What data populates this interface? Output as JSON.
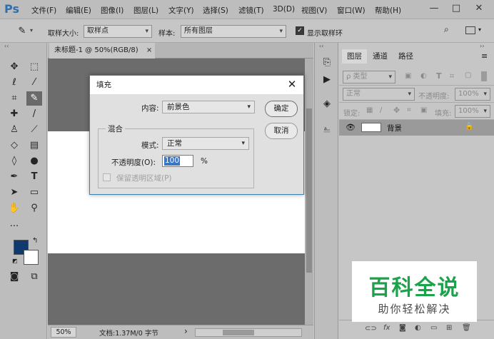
{
  "app": {
    "logo": "Ps"
  },
  "menu": [
    "文件(F)",
    "编辑(E)",
    "图像(I)",
    "图层(L)",
    "文字(Y)",
    "选择(S)",
    "滤镜(T)",
    "3D(D)",
    "视图(V)",
    "窗口(W)",
    "帮助(H)"
  ],
  "window_controls": {
    "minimize": "—",
    "restore": "□",
    "close": "✕"
  },
  "options": {
    "sample_size_label": "取样大小:",
    "sample_size_value": "取样点",
    "sample_label": "样本:",
    "sample_value": "所有图层",
    "show_ring_label": "显示取样环",
    "show_ring_checked": true
  },
  "document": {
    "tab_title": "未标题-1 @ 50%(RGB/8)",
    "tab_close": "×",
    "zoom": "50%",
    "doc_info": "文档:1.37M/0 字节",
    "status_arrow": "›"
  },
  "layers_panel": {
    "tabs": [
      "图层",
      "通道",
      "路径"
    ],
    "filter_kind": "ρ 类型",
    "blend_mode": "正常",
    "opacity_label": "不透明度:",
    "opacity_value": "100%",
    "lock_label": "锁定:",
    "fill_label": "填充:",
    "fill_value": "100%",
    "layer_name": "背景"
  },
  "fill_dialog": {
    "title": "填充",
    "content_label": "内容:",
    "content_value": "前景色",
    "blend_group": "混合",
    "mode_label": "模式:",
    "mode_value": "正常",
    "opacity_label": "不透明度(O):",
    "opacity_value": "100",
    "opacity_unit": "%",
    "preserve_label": "保留透明区域(P)",
    "ok": "确定",
    "cancel": "取消"
  },
  "colors": {
    "foreground": "#0f3a6e",
    "background": "#ffffff",
    "accent": "#3c7fb1"
  },
  "watermark": {
    "main": "百科全说",
    "sub": "助你轻松解决"
  }
}
